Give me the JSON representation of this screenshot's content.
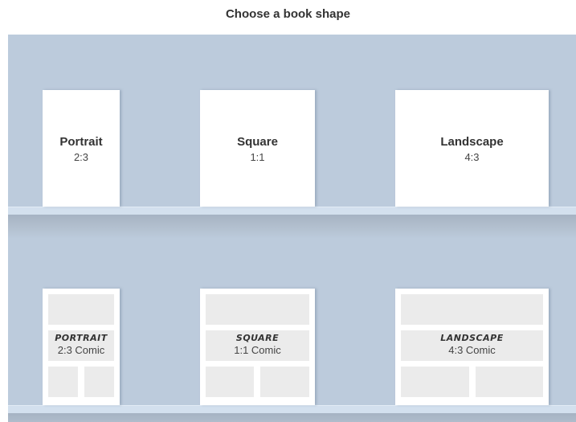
{
  "header": {
    "title": "Choose a book shape"
  },
  "shapes": [
    {
      "name": "Portrait",
      "ratio": "2:3"
    },
    {
      "name": "Square",
      "ratio": "1:1"
    },
    {
      "name": "Landscape",
      "ratio": "4:3"
    }
  ],
  "comics": [
    {
      "name": "PORTRAIT",
      "ratio": "2:3 Comic"
    },
    {
      "name": "SQUARE",
      "ratio": "1:1 Comic"
    },
    {
      "name": "LANDSCAPE",
      "ratio": "4:3 Comic"
    }
  ],
  "colors": {
    "background": "#bccbdc",
    "ledge": "#d3e0ee",
    "panel": "#ebebeb"
  }
}
